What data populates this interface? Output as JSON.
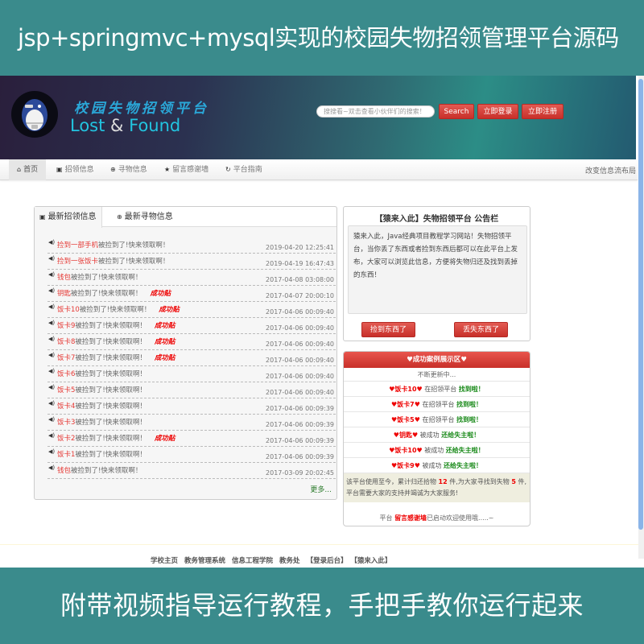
{
  "banner": {
    "top": "jsp+springmvc+mysql实现的校园失物招领管理平台源码",
    "bottom": "附带视频指导运行教程，手把手教你运行起来"
  },
  "header": {
    "logo_icon": "monkey-logo-icon",
    "title_cn": "校园失物招领平台",
    "title_en_1": "Lost",
    "title_en_amp": "&",
    "title_en_2": "Found",
    "search_placeholder": "搜搜看~双击查看小伙伴们的搜索！",
    "search_button": "Search",
    "login_button": "立即登录",
    "register_button": "立即注册"
  },
  "nav": {
    "items": [
      {
        "icon": "home-icon",
        "glyph": "⌂",
        "label": "首页"
      },
      {
        "icon": "picture-icon",
        "glyph": "▣",
        "label": "招领信息"
      },
      {
        "icon": "zoom-in-icon",
        "glyph": "⊕",
        "label": "寻物信息"
      },
      {
        "icon": "star-icon",
        "glyph": "★",
        "label": "留言感谢墙"
      },
      {
        "icon": "refresh-icon",
        "glyph": "↻",
        "label": "平台指南"
      }
    ],
    "right_link": "改变信息流布局"
  },
  "left_panel": {
    "tabs": [
      {
        "icon": "picture-icon",
        "glyph": "▣",
        "label": "最新招领信息"
      },
      {
        "icon": "zoom-in-icon",
        "glyph": "⊕",
        "label": "最新寻物信息"
      }
    ],
    "rows": [
      {
        "item": "捡到一部手机",
        "suffix": "被捡到了!快来领取啊！",
        "success": "",
        "date": "2019-04-20 12:25:41"
      },
      {
        "item": "捡到一张饭卡",
        "suffix": "被捡到了!快来领取啊！",
        "success": "",
        "date": "2019-04-19 16:47:43"
      },
      {
        "item": "钱包",
        "suffix": "被捡到了!快来领取啊！",
        "success": "",
        "date": "2017-04-08 03:08:00"
      },
      {
        "item": "钥匙",
        "suffix": "被捡到了!快来领取啊！",
        "success": "成功贴",
        "date": "2017-04-07 20:00:10"
      },
      {
        "item": "饭卡10",
        "suffix": "被捡到了!快来领取啊！",
        "success": "成功贴",
        "date": "2017-04-06 00:09:40"
      },
      {
        "item": "饭卡9",
        "suffix": "被捡到了!快来领取啊！",
        "success": "成功贴",
        "date": "2017-04-06 00:09:40"
      },
      {
        "item": "饭卡8",
        "suffix": "被捡到了!快来领取啊！",
        "success": "成功贴",
        "date": "2017-04-06 00:09:40"
      },
      {
        "item": "饭卡7",
        "suffix": "被捡到了!快来领取啊！",
        "success": "成功贴",
        "date": "2017-04-06 00:09:40"
      },
      {
        "item": "饭卡6",
        "suffix": "被捡到了!快来领取啊！",
        "success": "",
        "date": "2017-04-06 00:09:40"
      },
      {
        "item": "饭卡5",
        "suffix": "被捡到了!快来领取啊！",
        "success": "",
        "date": "2017-04-06 00:09:40"
      },
      {
        "item": "饭卡4",
        "suffix": "被捡到了!快来领取啊！",
        "success": "",
        "date": "2017-04-06 00:09:39"
      },
      {
        "item": "饭卡3",
        "suffix": "被捡到了!快来领取啊！",
        "success": "",
        "date": "2017-04-06 00:09:39"
      },
      {
        "item": "饭卡2",
        "suffix": "被捡到了!快来领取啊！",
        "success": "成功贴",
        "date": "2017-04-06 00:09:39"
      },
      {
        "item": "饭卡1",
        "suffix": "被捡到了!快来领取啊！",
        "success": "",
        "date": "2017-04-06 00:09:39"
      },
      {
        "item": "钱包",
        "suffix": "被捡到了!快来领取啊！",
        "success": "",
        "date": "2017-03-09 20:02:45"
      }
    ],
    "more": "更多..."
  },
  "notice": {
    "title": "【猿来入此】失物招领平台 公告栏",
    "body": "猿来入此，Java经典项目教程学习网站！失物招领平台，当你丢了东西或者捡到东西后都可以在此平台上发布，大家可以浏览此信息，方便将失物归还及找到丢掉的东西！",
    "found_button": "捡到东西了",
    "lost_button": "丢失东西了"
  },
  "cases": {
    "title": "♥成功案例展示区♥",
    "subtitle": "不断更新中...",
    "rows": [
      {
        "name": "♥饭卡10♥",
        "middle": " 在招领平台 ",
        "status": "找到啦！"
      },
      {
        "name": "♥饭卡7♥",
        "middle": " 在招领平台 ",
        "status": "找到啦！"
      },
      {
        "name": "♥饭卡5♥",
        "middle": " 在招领平台 ",
        "status": "找到啦！"
      },
      {
        "name": "♥钥匙♥",
        "middle": " 被成功 ",
        "status": "还给失主啦！"
      },
      {
        "name": "♥饭卡10♥",
        "middle": " 被成功 ",
        "status": "还给失主啦！"
      },
      {
        "name": "♥饭卡9♥",
        "middle": " 被成功 ",
        "status": "还给失主啦！"
      }
    ],
    "stats_prefix": "该平台使用至今，累计归还拾物 ",
    "returned_count": "12",
    "stats_middle": " 件,为大家寻找到失物 ",
    "found_count": "5",
    "stats_suffix": " 件, 平台需要大家的支持并竭诚为大家服务!",
    "footer_prefix": "平台 ",
    "footer_link": "留言感谢墙",
    "footer_suffix": "已启动欢迎使用哦.....~"
  },
  "footer": {
    "links": [
      "学校主页",
      "教务管理系统",
      "信息工程学院",
      "教务处",
      "【登录后台】",
      "【猿来入此】"
    ]
  }
}
